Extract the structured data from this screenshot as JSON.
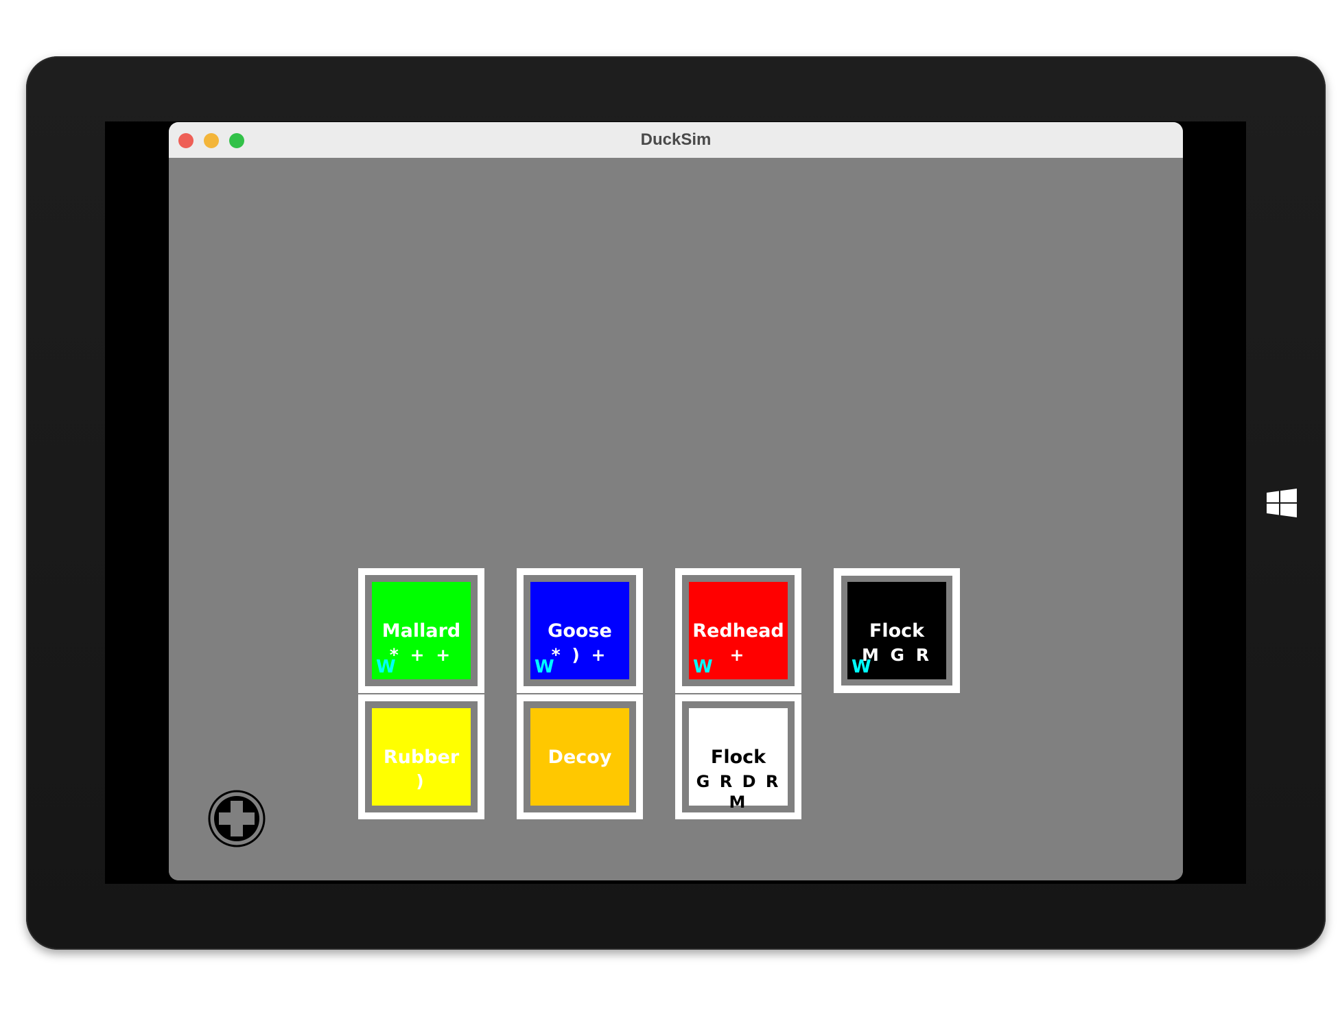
{
  "window": {
    "title": "DuckSim"
  },
  "icons": {
    "close": "window-close-icon",
    "minimize": "window-minimize-icon",
    "zoom": "window-zoom-icon",
    "add": "plus-circle-icon",
    "windows": "windows-logo-icon"
  },
  "colors": {
    "close": "#ee5f56",
    "minimize": "#f3b53a",
    "zoom": "#32c148",
    "canvas": "#808080",
    "card_border": "#ffffff",
    "w_marker": "#00ffff"
  },
  "cards": [
    {
      "name": "Mallard",
      "sub": "* + +",
      "w": "W",
      "bg": "#00ff00",
      "fg": "#ffffff"
    },
    {
      "name": "Goose",
      "sub": "* ) +",
      "w": "W",
      "bg": "#0000ff",
      "fg": "#ffffff"
    },
    {
      "name": "Redhead",
      "sub": "+",
      "w": "W",
      "bg": "#ff0000",
      "fg": "#ffffff"
    },
    {
      "name": "Flock",
      "sub": "M G R",
      "w": "W",
      "bg": "#000000",
      "fg": "#ffffff"
    },
    {
      "name": "Rubber",
      "sub": ")",
      "w": "",
      "bg": "#ffff00",
      "fg": "#ffffff"
    },
    {
      "name": "Decoy",
      "sub": "",
      "w": "",
      "bg": "#ffc800",
      "fg": "#ffffff"
    },
    {
      "name": "Flock",
      "sub": "G R D R M",
      "w": "",
      "bg": "#ffffff",
      "fg": "#000000"
    }
  ]
}
